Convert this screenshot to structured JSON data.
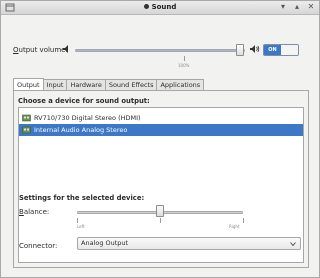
{
  "window": {
    "title": "Sound"
  },
  "output_volume": {
    "label_prefix": "O",
    "label_rest": "utput volume:",
    "level_percent": 97,
    "tick_label": "100%",
    "toggle_on": "ON",
    "toggle_off": ""
  },
  "tabs": [
    {
      "label": "Output",
      "active": true
    },
    {
      "label": "Input",
      "active": false
    },
    {
      "label": "Hardware",
      "active": false
    },
    {
      "label": "Sound Effects",
      "active": false
    },
    {
      "label": "Applications",
      "active": false
    }
  ],
  "devices": {
    "title": "Choose a device for sound output:",
    "items": [
      {
        "label": "RV710/730 Digital Stereo (HDMI)",
        "selected": false
      },
      {
        "label": "Internal Audio Analog Stereo",
        "selected": true
      }
    ]
  },
  "settings": {
    "title": "Settings for the selected device:",
    "balance_label_prefix": "B",
    "balance_label_rest": "alance:",
    "balance_value": 0.5,
    "balance_left": "Left",
    "balance_right": "Right",
    "connector_label": "Connector:",
    "connector_value": "Analog Output"
  },
  "colors": {
    "accent": "#3d78c7",
    "selected_text": "#ffffff"
  }
}
